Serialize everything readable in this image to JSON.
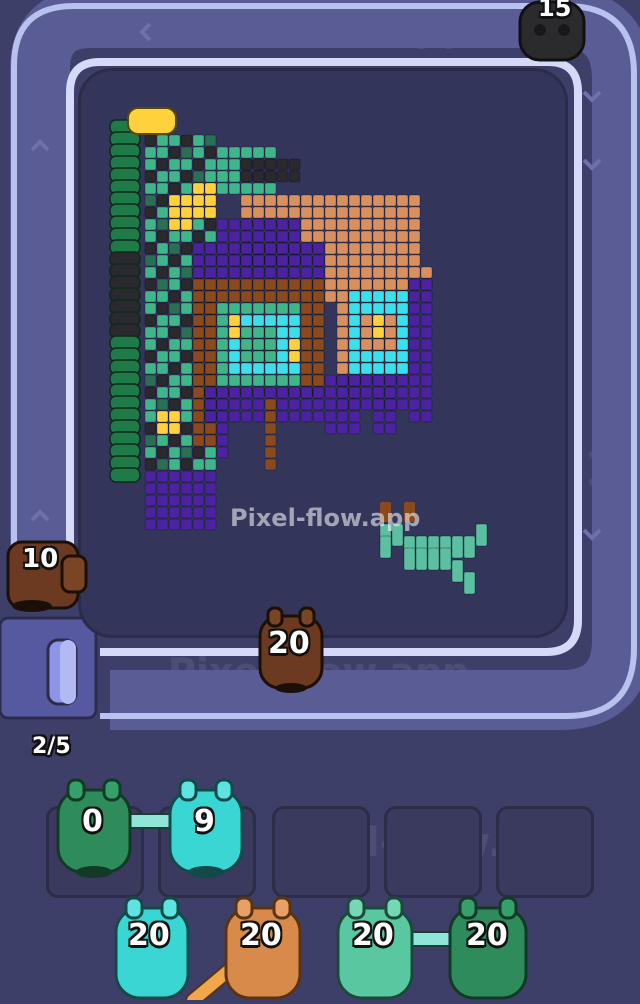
{
  "watermark": "Pixel-flow.app",
  "level_progress": "2/5",
  "conveyor_shooters": [
    {
      "id": "black-top",
      "count": "15",
      "color": "#2b2b2e"
    },
    {
      "id": "brown-left",
      "count": "10",
      "color": "#6b3a20"
    },
    {
      "id": "brown-bottom",
      "count": "20",
      "color": "#6b3a20"
    }
  ],
  "queue_slots": [
    {
      "count": "0",
      "color": "#2e8c5c"
    },
    {
      "count": "9",
      "color": "#39d6d3"
    },
    {
      "count": "",
      "color": ""
    },
    {
      "count": "",
      "color": ""
    },
    {
      "count": "",
      "color": ""
    }
  ],
  "waiting_shooters": [
    {
      "count": "20",
      "color": "#39d6d3"
    },
    {
      "count": "20",
      "color": "#d88a4a"
    },
    {
      "count": "20",
      "color": "#59c7a0"
    },
    {
      "count": "20",
      "color": "#2e8c5c"
    }
  ],
  "colors": {
    "background": "#3e3f69",
    "board": "#34355a",
    "rail": "#c9cff0",
    "teal": "#3fb58a",
    "dark_teal": "#2a6e54",
    "black": "#2a2a2e",
    "purple": "#4b22a0",
    "brown": "#8a4a1e",
    "peach": "#d9905f",
    "cyan": "#3ae0ec",
    "yellow": "#ffd23c",
    "green": "#1f7a4a"
  }
}
